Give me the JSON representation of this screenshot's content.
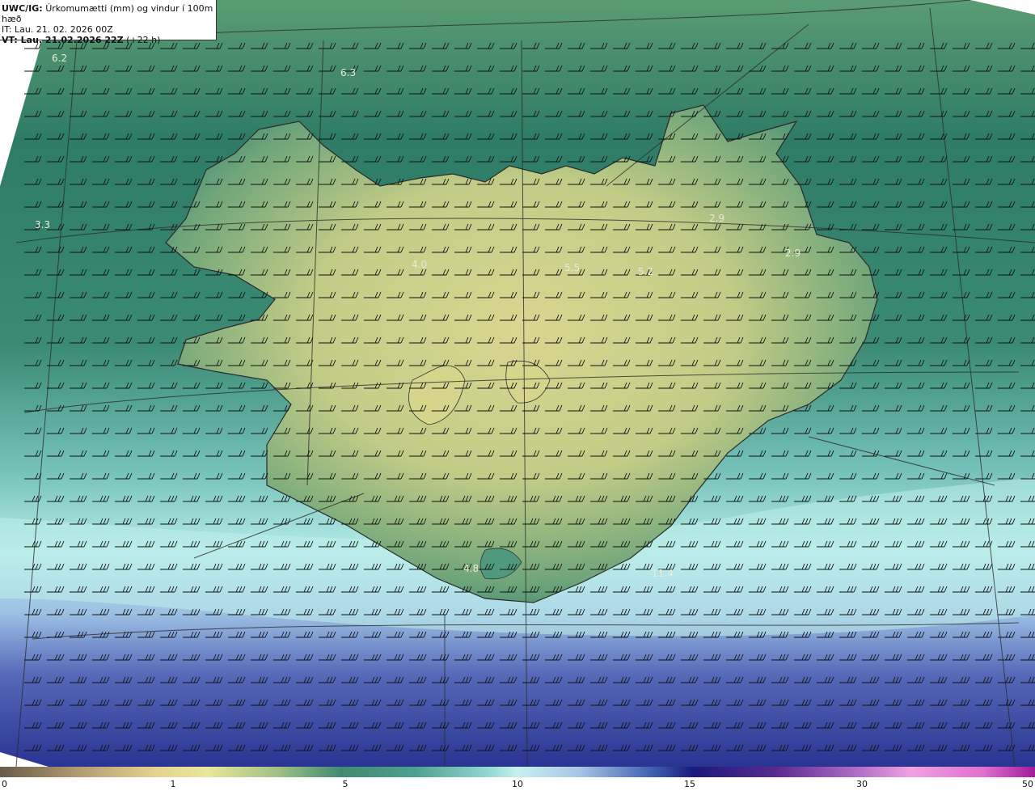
{
  "header": {
    "prefix": "UWC/IG:",
    "title": "Úrkomumætti (mm) og vindur í 100m hæð",
    "it_line": "IT: Lau. 21. 02. 2026 00Z",
    "vt_strong": "VT: Lau. 21.02.2026 22Z",
    "vt_offset": "(+22 h)"
  },
  "map_labels": [
    "6.2",
    "6.3",
    "3.3",
    "4.0",
    "5.5",
    "5.2",
    "2.9",
    "2.9",
    "4.8",
    "11.4"
  ],
  "colorbar": {
    "ticks": [
      "0",
      "1",
      "5",
      "10",
      "15",
      "30",
      "50"
    ]
  },
  "colors": {
    "land_high": "#d8d48a",
    "coast_green": "#3f8a72",
    "sea_green": "#2e7a64",
    "sea_cyan": "#a8e4e2",
    "sea_blue": "#3d54a8",
    "barb": "#111111"
  }
}
